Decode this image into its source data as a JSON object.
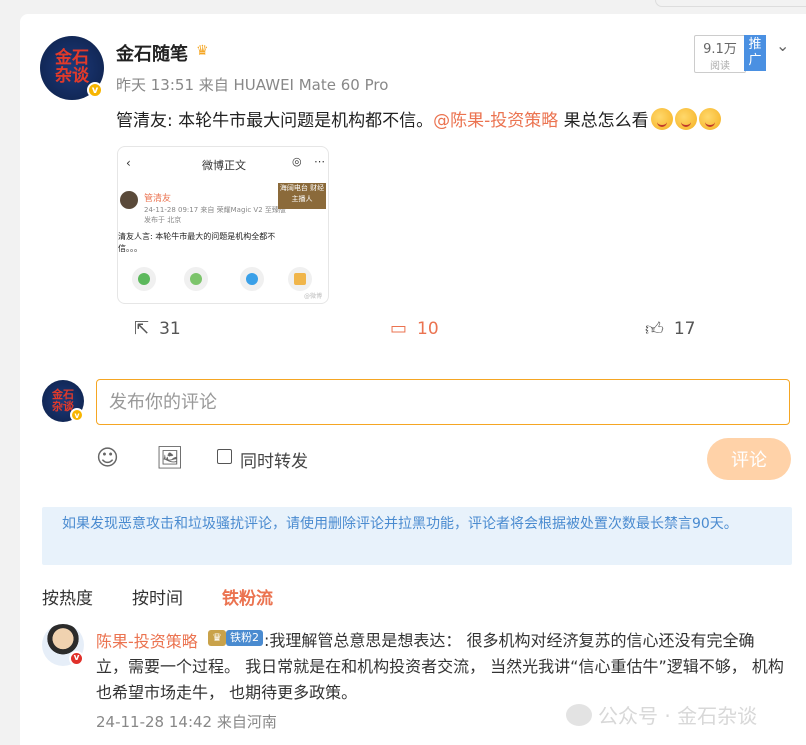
{
  "post": {
    "author": "金石随笔",
    "avatar_text": "金石\n杂谈",
    "meta": "昨天 13:51 来自 HUAWEI Mate 60 Pro",
    "read_count": "9.1万",
    "read_label": "阅读",
    "push_label": "推广",
    "text_before": "管清友: 本轮牛市最大问题是机构都不信。",
    "mention": "@陈果-投资策略",
    "text_after": " 果总怎么看"
  },
  "thumbnail": {
    "title": "微博正文",
    "name": "管清友",
    "date": "24-11-28 09:17 来自 荣耀Magic V2 至臻版",
    "location": "发布于 北京",
    "banner": "海阔电台 财经主播人",
    "body": "清友人言: 本轮牛市最大的问题是机构全都不",
    "dots": "信。。。",
    "watermark": "@微博"
  },
  "actions": {
    "repost": "31",
    "comment": "10",
    "like": "17"
  },
  "composer": {
    "placeholder": "发布你的评论",
    "repost_label": "同时转发",
    "submit": "评论"
  },
  "notice": "如果发现恶意攻击和垃圾骚扰评论，请使用删除评论并拉黑功能，评论者将会根据被处置次数最长禁言90天。",
  "sort_tabs": [
    "按热度",
    "按时间",
    "铁粉流"
  ],
  "comment": {
    "name": "陈果-投资策略",
    "fan_badge": "铁粉2",
    "text": ":我理解管总意思是想表达： 很多机构对经济复苏的信心还没有完全确立，需要一个过程。 我日常就是在和机构投资者交流， 当然光我讲“信心重估牛”逻辑不够， 机构也希望市场走牛， 也期待更多政策。",
    "time": "24-11-28 14:42 来自河南"
  },
  "watermark": "公众号 · 金石杂谈"
}
